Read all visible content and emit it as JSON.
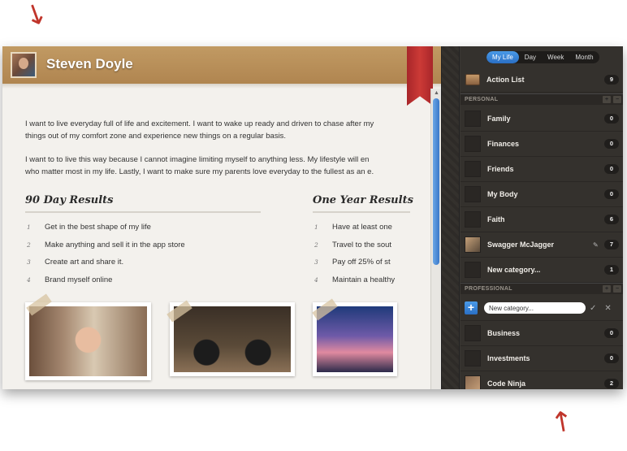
{
  "profile": {
    "name": "Steven Doyle"
  },
  "intro": {
    "p1_line1": "I want to live everyday full of life and excitement. I want to wake up ready and driven to chase after my",
    "p1_line2": "things out of my comfort zone and experience new things on a regular basis.",
    "p2_line1": "I want to to live this way because I cannot imagine limiting myself to anything less. My lifestyle will en",
    "p2_line2": "who matter most in my life. Lastly, I want to make sure my parents love everyday to the fullest as an e."
  },
  "results_90": {
    "title": "90 Day Results",
    "items": [
      {
        "num": "1",
        "text": "Get in the best shape of my life"
      },
      {
        "num": "2",
        "text": "Make anything and sell it in the app store"
      },
      {
        "num": "3",
        "text": "Create art and share it."
      },
      {
        "num": "4",
        "text": "Brand myself online"
      }
    ]
  },
  "results_year": {
    "title": "One Year Results",
    "items": [
      {
        "num": "1",
        "text": "Have at least one"
      },
      {
        "num": "2",
        "text": "Travel to the sout"
      },
      {
        "num": "3",
        "text": "Pay off 25% of st"
      },
      {
        "num": "4",
        "text": "Maintain a healthy"
      }
    ]
  },
  "tabs": [
    "My Life",
    "Day",
    "Week",
    "Month"
  ],
  "action_list": {
    "label": "Action List",
    "count": "9"
  },
  "personal": {
    "header": "PERSONAL",
    "items": [
      {
        "label": "Family",
        "count": "0"
      },
      {
        "label": "Finances",
        "count": "0"
      },
      {
        "label": "Friends",
        "count": "0"
      },
      {
        "label": "My Body",
        "count": "0"
      },
      {
        "label": "Faith",
        "count": "6"
      },
      {
        "label": "Swagger McJagger",
        "count": "7"
      },
      {
        "label": "New category...",
        "count": "1"
      }
    ]
  },
  "professional": {
    "header": "PROFESSIONAL",
    "new_category_value": "New category...",
    "items": [
      {
        "label": "Business",
        "count": "0"
      },
      {
        "label": "Investments",
        "count": "0"
      },
      {
        "label": "Code Ninja",
        "count": "2"
      }
    ]
  },
  "icons": {
    "add": "+",
    "remove": "−",
    "confirm": "✓",
    "cancel": "✕",
    "edit": "✎",
    "scroll_up": "▲",
    "arrow_down": "↓",
    "arrow_up": "↑"
  },
  "colors": {
    "accent_blue": "#2a6fc4",
    "header_tan": "#b08550",
    "ribbon_red": "#cc3a36",
    "sidebar_bg": "#34312d",
    "annotation_red": "#c0352b"
  }
}
